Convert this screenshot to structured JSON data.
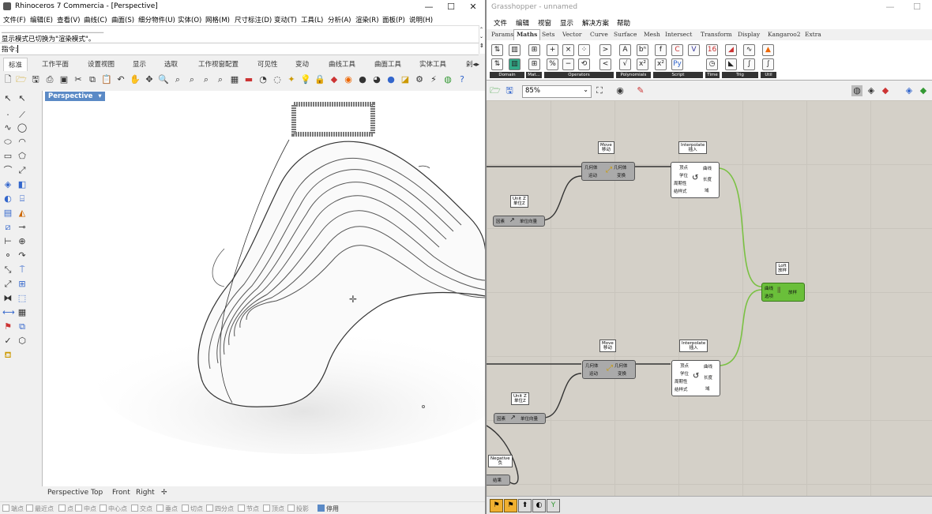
{
  "rhino": {
    "title": "Rhinoceros 7 Commercia - [Perspective]",
    "window_buttons": [
      "—",
      "☐",
      "✕"
    ],
    "menu": [
      "文件(F)",
      "编辑(E)",
      "查看(V)",
      "曲线(C)",
      "曲面(S)",
      "细分物件(U)",
      "实体(O)",
      "网格(M)",
      "尺寸标注(D)",
      "变动(T)",
      "工具(L)",
      "分析(A)",
      "渲染(R)",
      "面板(P)",
      "说明(H)"
    ],
    "command_history": [
      "显示模式已切换为\"渲染模式\"。"
    ],
    "command_prompt": "指令:",
    "tabs": [
      "标准",
      "工作平面",
      "设置视图",
      "显示",
      "选取",
      "工作视窗配置",
      "可见性",
      "变动",
      "曲线工具",
      "曲面工具",
      "实体工具"
    ],
    "active_tab": "标准",
    "viewport_label": "Perspective",
    "viewport_tabs": [
      "Perspective",
      "Top",
      "Front",
      "Right"
    ],
    "osnaps": [
      "端点",
      "最近点",
      "点",
      "中点",
      "中心点",
      "交点",
      "垂点",
      "切点",
      "四分点",
      "节点",
      "顶点",
      "投影",
      "停用"
    ]
  },
  "grasshopper": {
    "title": "Grasshopper - unnamed",
    "window_buttons": [
      "—",
      "☐"
    ],
    "menu": [
      "文件",
      "编辑",
      "视窗",
      "显示",
      "解决方案",
      "帮助"
    ],
    "tabs": [
      "Params",
      "Maths",
      "Sets",
      "Vector",
      "Curve",
      "Surface",
      "Mesh",
      "Intersect",
      "Transform",
      "Display",
      "Kangaroo2",
      "Extra"
    ],
    "active_tab": "Maths",
    "groups": [
      "Domain",
      "Mat...",
      "Operators",
      "Polynomials",
      "Script",
      "Time",
      "Trig",
      "Util"
    ],
    "zoom": "85%",
    "nodes": {
      "move1": {
        "label": [
          "Move",
          "移动"
        ],
        "inputs": [
          "几何体",
          "运动"
        ],
        "outputs": [
          "几何体",
          "变换"
        ]
      },
      "interp1": {
        "label": [
          "Interpolate",
          "插入"
        ],
        "inputs": [
          "顶点",
          "学位",
          "周期性",
          "结样式"
        ],
        "outputs": [
          "曲线",
          "长度",
          "域"
        ]
      },
      "unitz1": {
        "label": [
          "Unit Z",
          "单位Z"
        ],
        "inputs": [
          "因素"
        ],
        "outputs": [
          "单位向量"
        ]
      },
      "loft": {
        "label": [
          "Loft",
          "放样"
        ],
        "inputs": [
          "曲线",
          "选项"
        ],
        "outputs": [
          "放样"
        ]
      },
      "move2": {
        "label": [
          "Move",
          "移动"
        ],
        "inputs": [
          "几何体",
          "运动"
        ],
        "outputs": [
          "几何体",
          "变换"
        ]
      },
      "interp2": {
        "label": [
          "Interpolate",
          "插入"
        ],
        "inputs": [
          "顶点",
          "学位",
          "周期性",
          "结样式"
        ],
        "outputs": [
          "曲线",
          "长度",
          "域"
        ]
      },
      "unitz2": {
        "label": [
          "Unit Z",
          "单位Z"
        ],
        "inputs": [
          "因素"
        ],
        "outputs": [
          "单位向量"
        ]
      },
      "negative": {
        "label": [
          "Negative",
          "负"
        ],
        "outputs": [
          "结果"
        ]
      }
    },
    "colors": {
      "wire": "#333333",
      "wire_selected": "#7ac143",
      "node_selected": "#6abf3a",
      "canvas": "#d4d0c8"
    }
  }
}
